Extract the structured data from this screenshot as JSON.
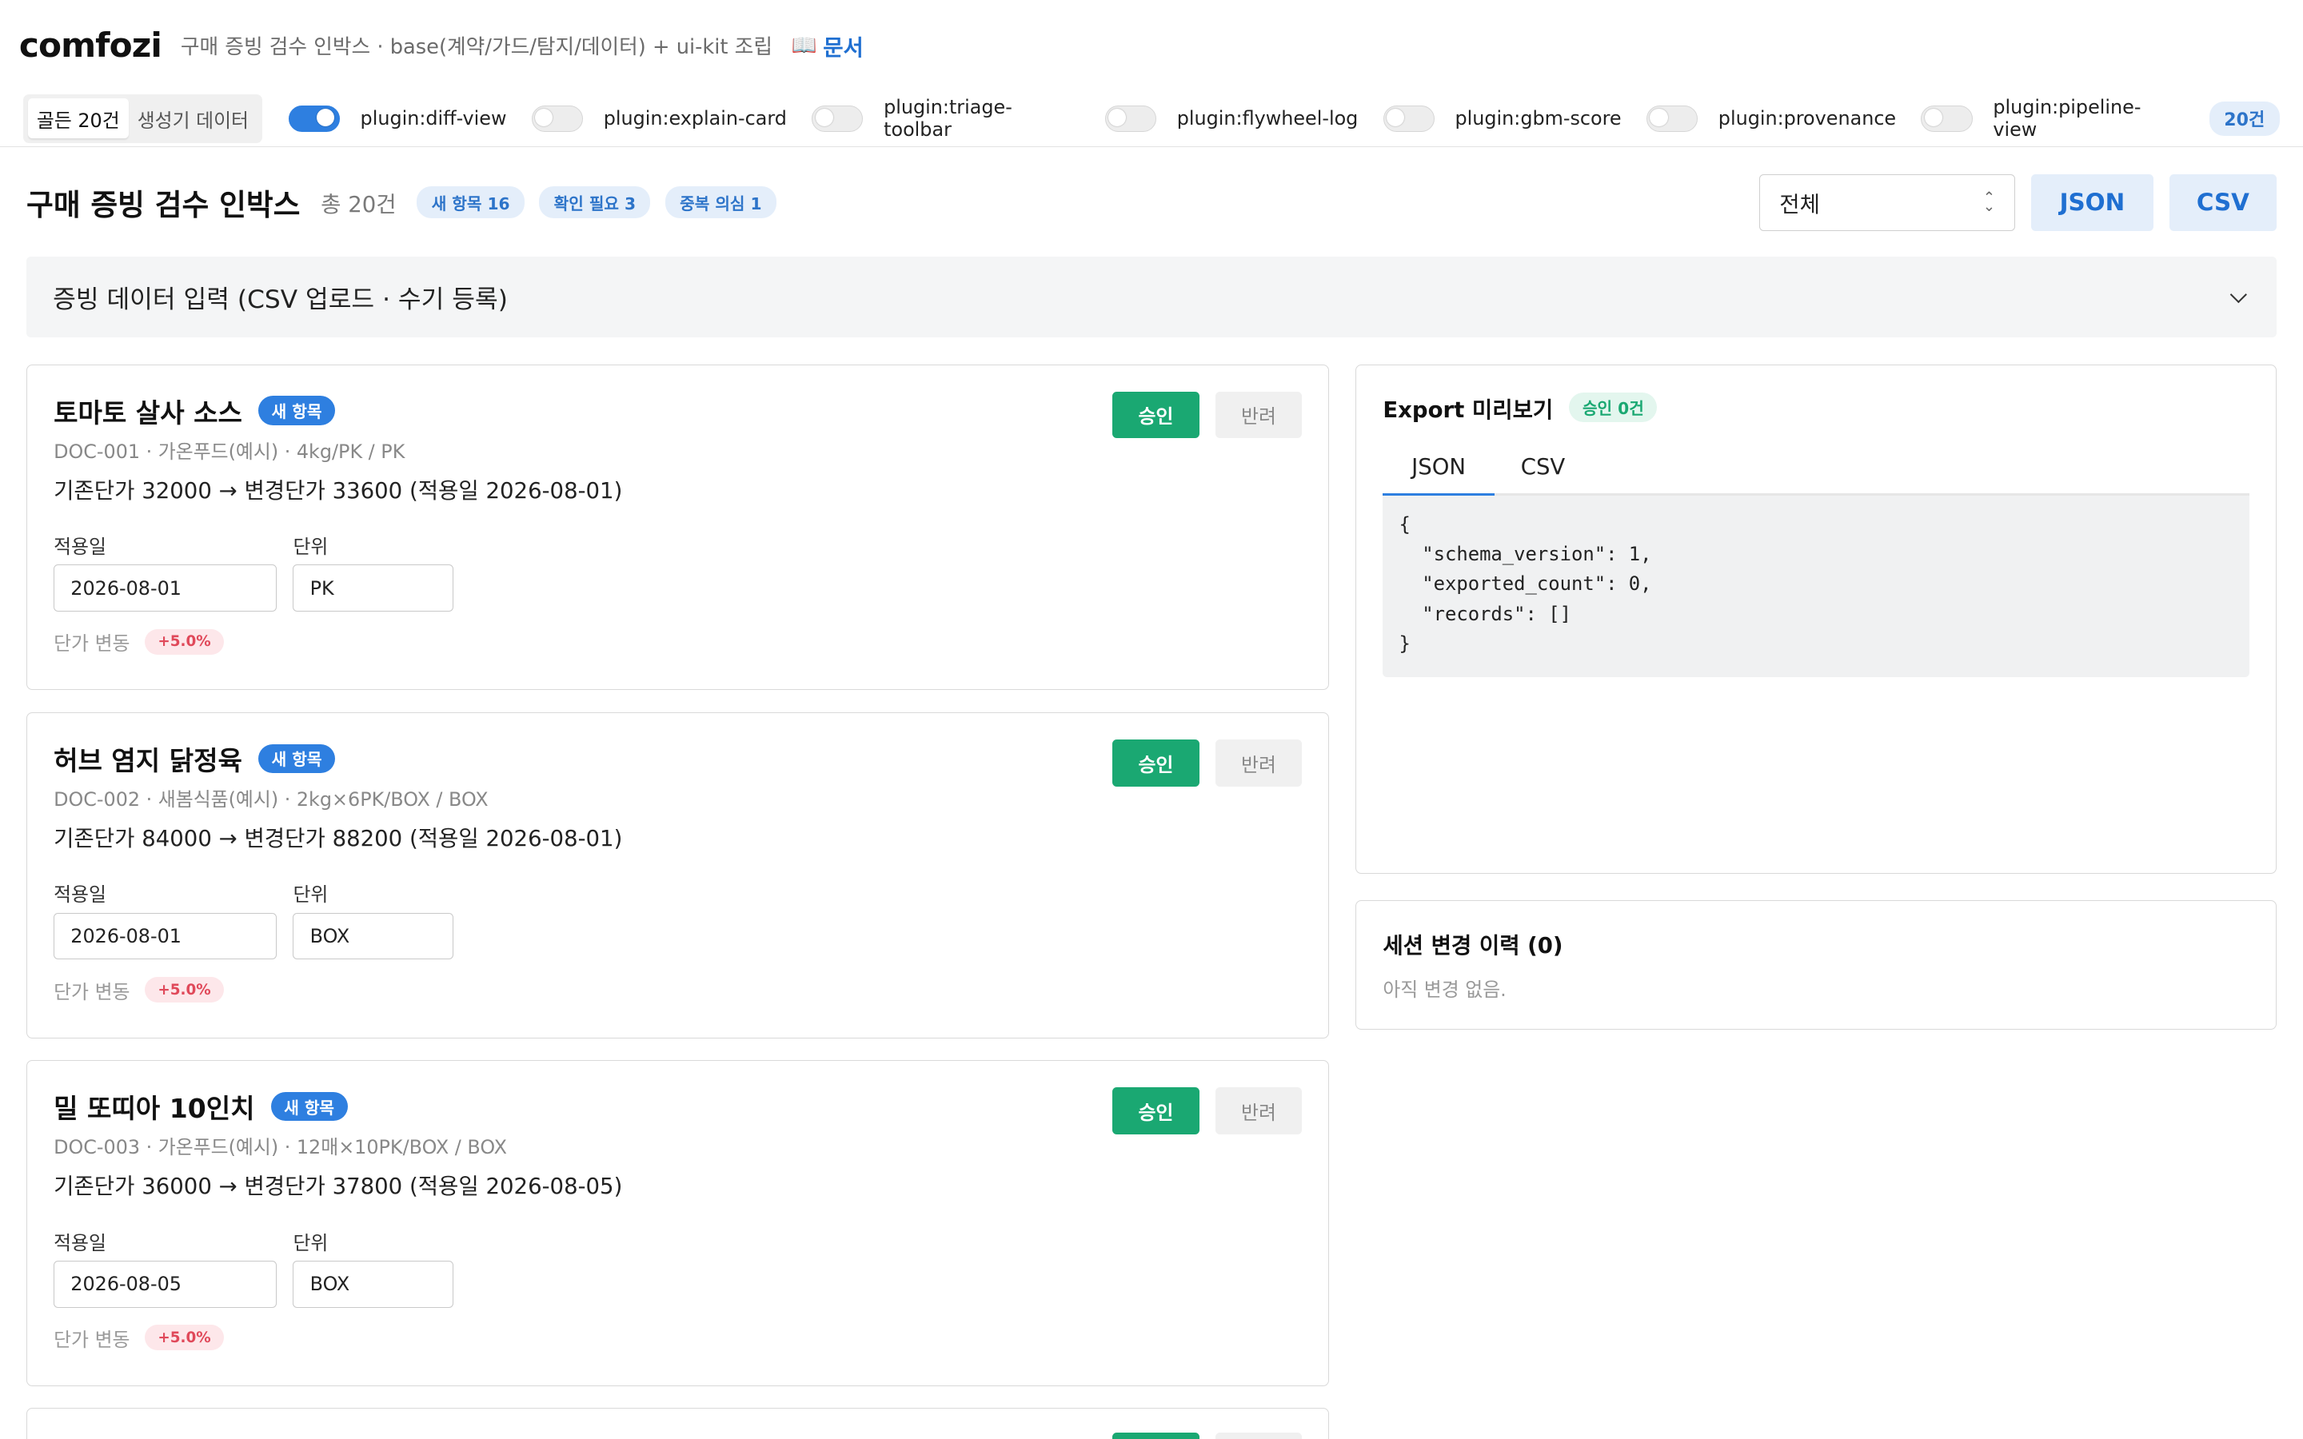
{
  "header": {
    "brand": "comfozi",
    "tagline": "구매 증빙 검수 인박스 · base(계약/가드/탐지/데이터) + ui-kit 조립",
    "doc_icon": "📖",
    "doc_link": "문서"
  },
  "toolbar": {
    "segments": [
      "골든 20건",
      "생성기 데이터"
    ],
    "active_segment": 0,
    "plugins": [
      {
        "label": "plugin:diff-view",
        "on": true
      },
      {
        "label": "plugin:explain-card",
        "on": false
      },
      {
        "label": "plugin:triage-toolbar",
        "on": false
      },
      {
        "label": "plugin:flywheel-log",
        "on": false
      },
      {
        "label": "plugin:gbm-score",
        "on": false
      },
      {
        "label": "plugin:provenance",
        "on": false
      },
      {
        "label": "plugin:pipeline-view",
        "on": false
      }
    ],
    "count_badge": "20건"
  },
  "title_row": {
    "title": "구매 증빙 검수 인박스",
    "total": "총 20건",
    "chips": [
      "새 항목 16",
      "확인 필요 3",
      "중복 의심 1"
    ],
    "filter_value": "전체",
    "json_button": "JSON",
    "csv_button": "CSV"
  },
  "input_panel": {
    "label": "증빙 데이터 입력 (CSV 업로드 · 수기 등록)"
  },
  "cards": [
    {
      "title": "토마토 살사 소스",
      "badge": "새 항목",
      "meta": "DOC-001 · 가온푸드(예시) · 4kg/PK / PK",
      "price_line": "기존단가 32000 → 변경단가 33600 (적용일 2026-08-01)",
      "date_label": "적용일",
      "date_value": "2026-08-01",
      "unit_label": "단위",
      "unit_value": "PK",
      "delta_label": "단가 변동",
      "delta_value": "+5.0%",
      "approve": "승인",
      "reject": "반려"
    },
    {
      "title": "허브 염지 닭정육",
      "badge": "새 항목",
      "meta": "DOC-002 · 새봄식품(예시) · 2kg×6PK/BOX / BOX",
      "price_line": "기존단가 84000 → 변경단가 88200 (적용일 2026-08-01)",
      "date_label": "적용일",
      "date_value": "2026-08-01",
      "unit_label": "단위",
      "unit_value": "BOX",
      "delta_label": "단가 변동",
      "delta_value": "+5.0%",
      "approve": "승인",
      "reject": "반려"
    },
    {
      "title": "밀 또띠아 10인치",
      "badge": "새 항목",
      "meta": "DOC-003 · 가온푸드(예시) · 12매×10PK/BOX / BOX",
      "price_line": "기존단가 36000 → 변경단가 37800 (적용일 2026-08-05)",
      "date_label": "적용일",
      "date_value": "2026-08-05",
      "unit_label": "단위",
      "unit_value": "BOX",
      "delta_label": "단가 변동",
      "delta_value": "+5.0%",
      "approve": "승인",
      "reject": "반려"
    }
  ],
  "export": {
    "title": "Export 미리보기",
    "badge": "승인 0건",
    "tabs": [
      "JSON",
      "CSV"
    ],
    "active_tab": 0,
    "code_lines": [
      "{",
      "  \"schema_version\": 1,",
      "  \"exported_count\": 0,",
      "  \"records\": []",
      "}"
    ]
  },
  "history": {
    "title": "세션 변경 이력 (0)",
    "empty": "아직 변경 없음."
  },
  "colors": {
    "accent": "#2e7fe0",
    "approve": "#1aa872",
    "delta": "#e0495a"
  }
}
